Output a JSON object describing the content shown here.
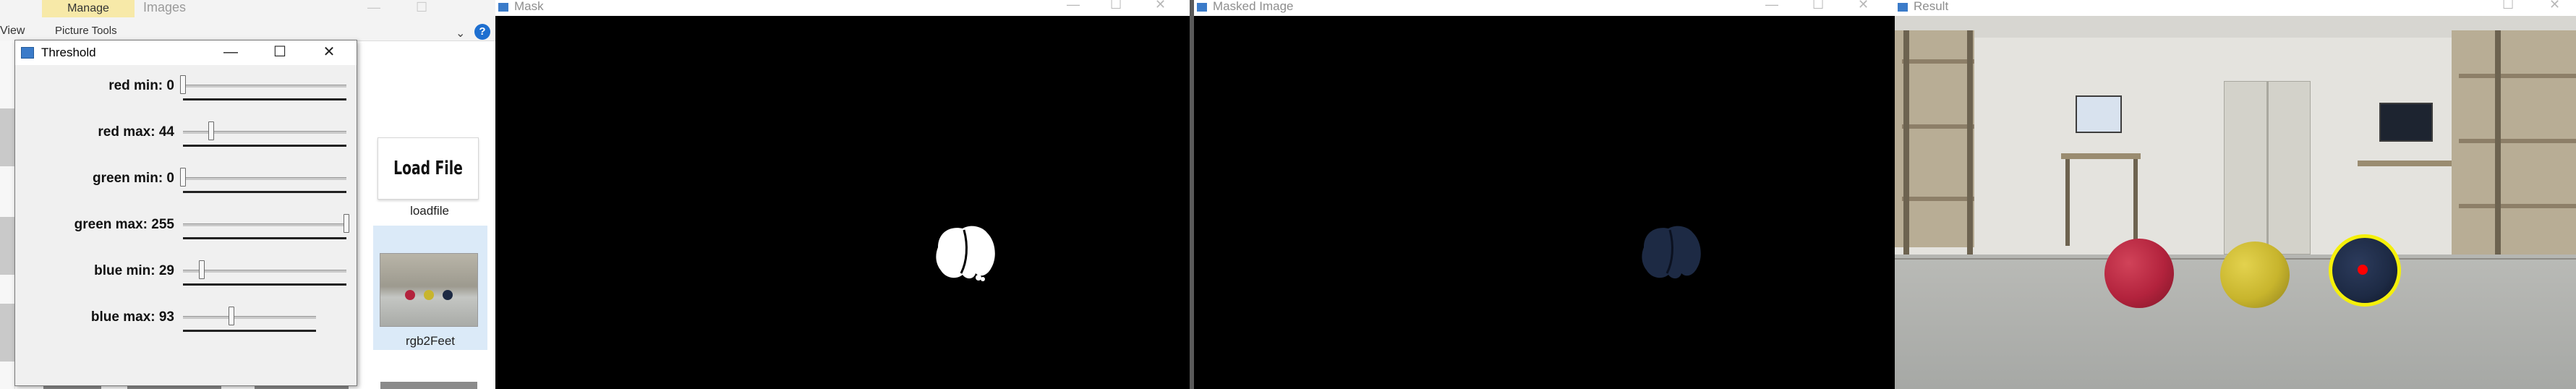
{
  "explorer": {
    "manage_tab": "Manage",
    "title": "Images",
    "view_tab": "View",
    "picture_tools": "Picture Tools",
    "help_glyph": "?",
    "ribbon_chevron": "⌄",
    "items": [
      {
        "button_text": "Load File",
        "label": "loadfile"
      },
      {
        "label": "rgb2Feet"
      }
    ]
  },
  "threshold_window": {
    "title": "Threshold",
    "controls": {
      "minimize": "—",
      "maximize": "☐",
      "close": "✕"
    },
    "sliders": [
      {
        "label": "red min: 0",
        "value": 0,
        "max": 255
      },
      {
        "label": "red max: 44",
        "value": 44,
        "max": 255
      },
      {
        "label": "green min: 0",
        "value": 0,
        "max": 255
      },
      {
        "label": "green max: 255",
        "value": 255,
        "max": 255
      },
      {
        "label": "blue min: 29",
        "value": 29,
        "max": 255
      },
      {
        "label": "blue max: 93",
        "value": 93,
        "max": 255
      }
    ]
  },
  "windows": {
    "mask": {
      "title": "Mask"
    },
    "masked": {
      "title": "Masked Image"
    },
    "result": {
      "title": "Result"
    }
  },
  "colors": {
    "ball_red": "#b3233d",
    "ball_yellow": "#c8b52d",
    "ball_dark": "#1d2a44",
    "detect_circle": "#f5f00a",
    "center_dot": "#ff0000",
    "selection": "#dbeaf8",
    "manage_tab": "#f7e9a8"
  }
}
